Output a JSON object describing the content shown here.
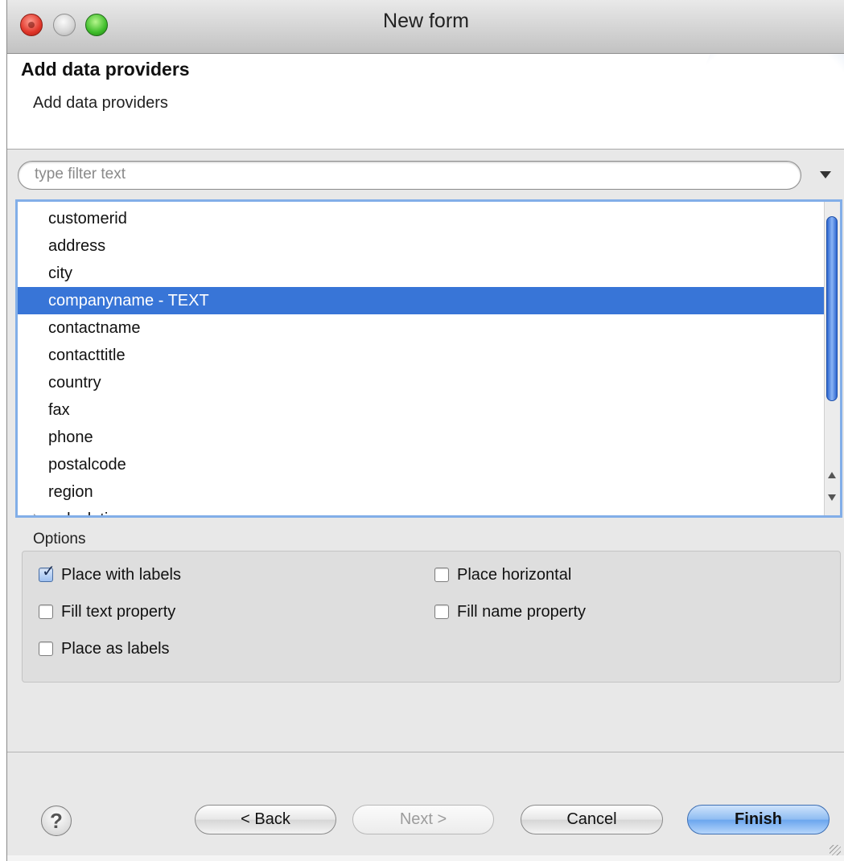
{
  "window": {
    "title": "New form"
  },
  "header": {
    "title": "Add data providers",
    "subtitle": "Add data providers"
  },
  "filter": {
    "placeholder": "type filter text"
  },
  "list": {
    "items": [
      "customerid",
      "address",
      "city",
      "companyname - TEXT",
      "contactname",
      "contacttitle",
      "country",
      "fax",
      "phone",
      "postalcode",
      "region",
      "calculations"
    ],
    "selected_index": 3
  },
  "options": {
    "label": "Options",
    "items": [
      {
        "label": "Place with labels",
        "checked": true
      },
      {
        "label": "Place horizontal",
        "checked": false
      },
      {
        "label": "Fill text property",
        "checked": false
      },
      {
        "label": "Fill name property",
        "checked": false
      },
      {
        "label": "Place as labels",
        "checked": false
      }
    ]
  },
  "buttons": {
    "help": "?",
    "back": "< Back",
    "next": "Next >",
    "cancel": "Cancel",
    "finish": "Finish"
  }
}
